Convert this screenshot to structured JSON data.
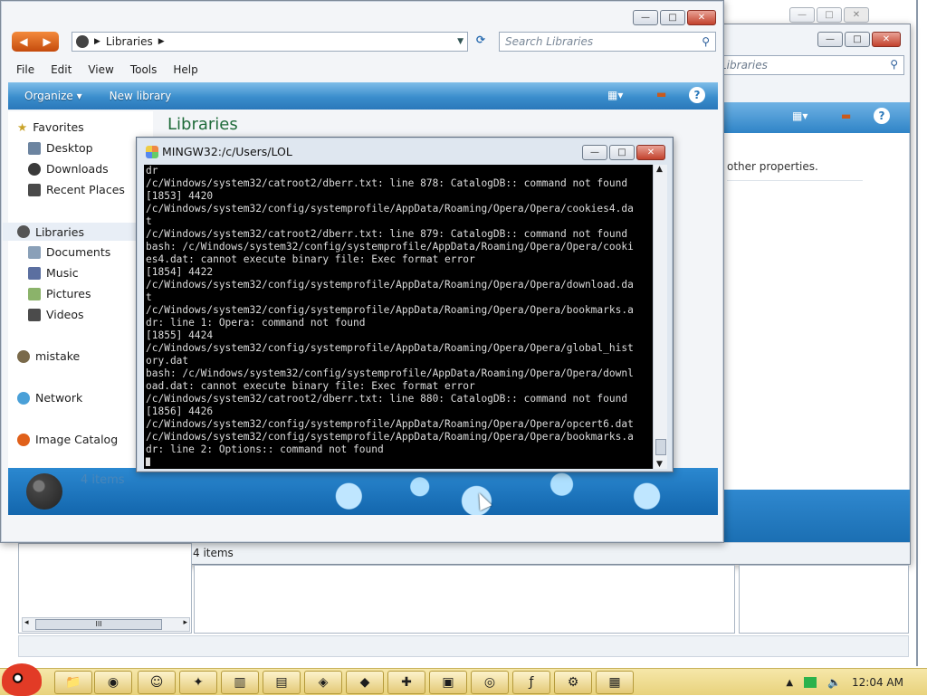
{
  "bg_window": {
    "search_placeholder": "Libraries",
    "side_text": "other properties.",
    "status": "4 items"
  },
  "main_window": {
    "address": "Libraries",
    "search_placeholder": "Search Libraries",
    "menu": [
      "File",
      "Edit",
      "View",
      "Tools",
      "Help"
    ],
    "toolbar": {
      "organize": "Organize",
      "new_library": "New library"
    },
    "nav": {
      "favorites": "Favorites",
      "desktop": "Desktop",
      "downloads": "Downloads",
      "recent": "Recent Places",
      "libraries": "Libraries",
      "documents": "Documents",
      "music": "Music",
      "pictures": "Pictures",
      "videos": "Videos",
      "mistake": "mistake",
      "network": "Network",
      "image_catalog": "Image Catalog"
    },
    "content_title": "Libraries",
    "details_count": "4 items"
  },
  "terminal": {
    "title": "MINGW32:/c/Users/LOL",
    "lines": [
      "dr",
      "/c/Windows/system32/catroot2/dberr.txt: line 878: CatalogDB:: command not found",
      "[1853] 4420",
      "/c/Windows/system32/config/systemprofile/AppData/Roaming/Opera/Opera/cookies4.da",
      "t",
      "/c/Windows/system32/catroot2/dberr.txt: line 879: CatalogDB:: command not found",
      "bash: /c/Windows/system32/config/systemprofile/AppData/Roaming/Opera/Opera/cooki",
      "es4.dat: cannot execute binary file: Exec format error",
      "[1854] 4422",
      "/c/Windows/system32/config/systemprofile/AppData/Roaming/Opera/Opera/download.da",
      "t",
      "/c/Windows/system32/config/systemprofile/AppData/Roaming/Opera/Opera/bookmarks.a",
      "dr: line 1: Opera: command not found",
      "[1855] 4424",
      "/c/Windows/system32/config/systemprofile/AppData/Roaming/Opera/Opera/global_hist",
      "ory.dat",
      "bash: /c/Windows/system32/config/systemprofile/AppData/Roaming/Opera/Opera/downl",
      "oad.dat: cannot execute binary file: Exec format error",
      "/c/Windows/system32/catroot2/dberr.txt: line 880: CatalogDB:: command not found",
      "[1856] 4426",
      "/c/Windows/system32/config/systemprofile/AppData/Roaming/Opera/Opera/opcert6.dat",
      "/c/Windows/system32/config/systemprofile/AppData/Roaming/Opera/Opera/bookmarks.a",
      "dr: line 2: Options:: command not found",
      ""
    ]
  },
  "taskbar": {
    "clock": "12:04 AM",
    "apps": [
      "folder-icon",
      "chrome-icon",
      "smiley-icon",
      "colorful-app-icon",
      "calculator-icon",
      "archive-icon",
      "app-icon",
      "vs-icon",
      "puzzle-icon",
      "monitor-icon",
      "disc-icon",
      "flash-icon",
      "settings-icon",
      "explorer-icon"
    ]
  },
  "colors": {
    "toolbar_blue": "#3a8dcc",
    "title_green": "#1f6b3a",
    "taskbar_yellow": "#e8d27c"
  }
}
